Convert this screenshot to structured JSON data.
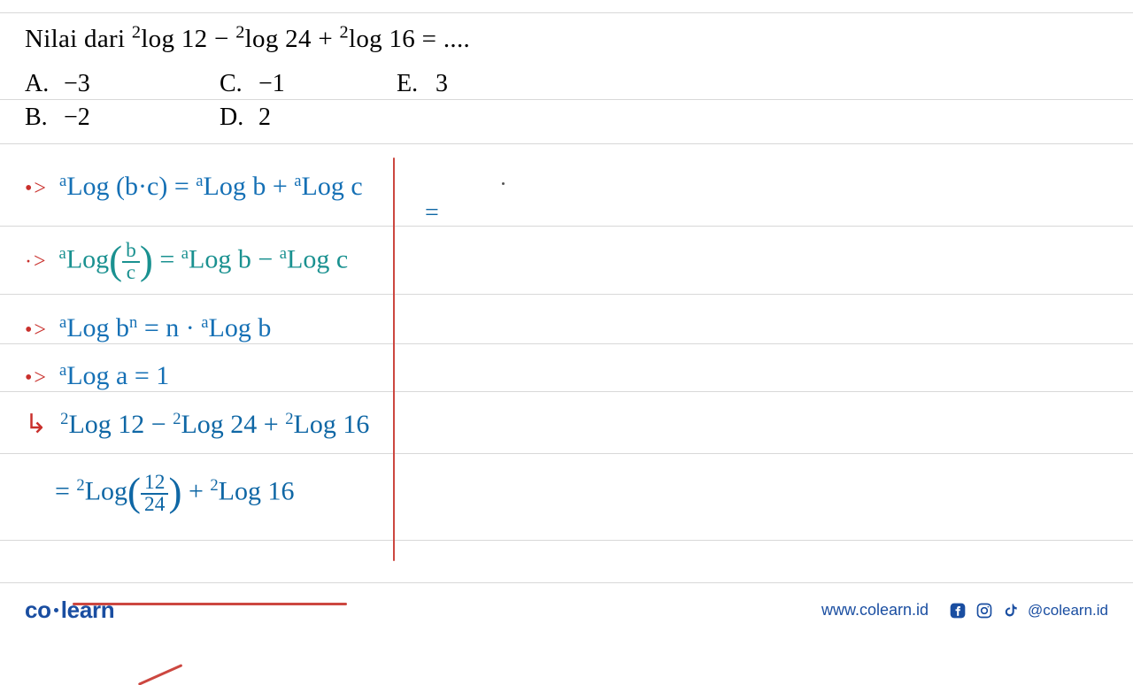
{
  "question_text": "Nilai dari ²log 12 − ²log 24 + ²log 16 = ....",
  "options": {
    "A": "−3",
    "B": "−2",
    "C": "−1",
    "D": "2",
    "E": "3"
  },
  "handwriting": {
    "rule1_text": "ᵃLog (b·c) = ᵃLog b + ᵃLog c",
    "rule2_text": "ᵃLog (b/c) = ᵃLog b − ᵃLog c",
    "rule3_text": "ᵃLog bⁿ = n · ᵃLog b",
    "rule4_text": "ᵃLog a = 1",
    "step1_text": "²Log 12 − ²Log 24 + ²Log 16",
    "step2_text": "= ²Log (12/24) + ²Log 16",
    "right_equals": "="
  },
  "footer": {
    "logo": "co learn",
    "url": "www.colearn.id",
    "handle": "@colearn.id"
  },
  "colors": {
    "blue_ink": "#1570b5",
    "teal_ink": "#1a9190",
    "red_ink": "#cc4740",
    "brand": "#1a4ea1"
  }
}
